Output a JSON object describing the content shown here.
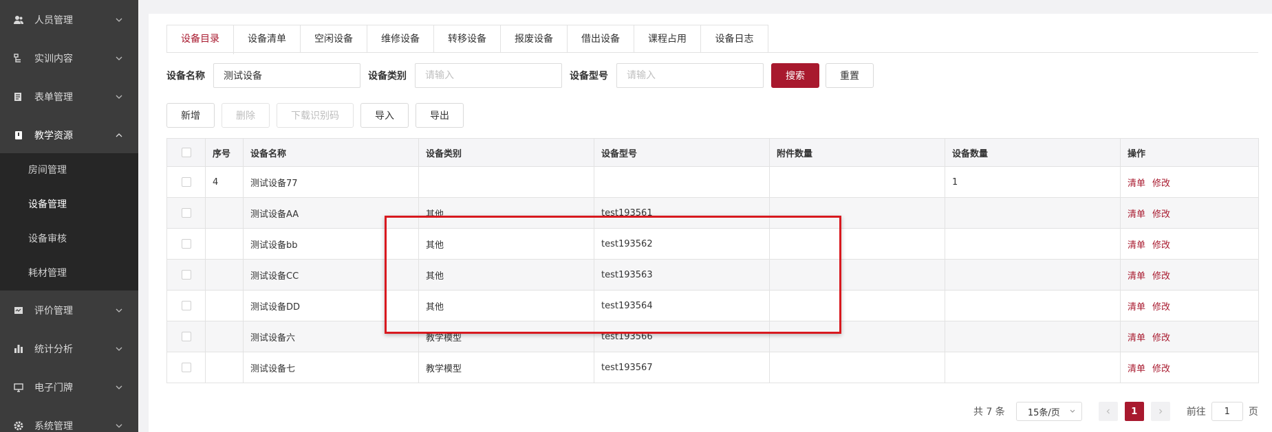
{
  "sidebar": {
    "items": [
      {
        "label": "人员管理",
        "icon": "users-icon"
      },
      {
        "label": "实训内容",
        "icon": "list-icon"
      },
      {
        "label": "表单管理",
        "icon": "form-icon"
      },
      {
        "label": "教学资源",
        "icon": "book-icon"
      },
      {
        "label": "评价管理",
        "icon": "evaluate-icon"
      },
      {
        "label": "统计分析",
        "icon": "bar-chart-icon"
      },
      {
        "label": "电子门牌",
        "icon": "monitor-icon"
      },
      {
        "label": "系统管理",
        "icon": "gear-icon"
      }
    ],
    "submenu": [
      {
        "label": "房间管理"
      },
      {
        "label": "设备管理",
        "active": true
      },
      {
        "label": "设备审核"
      },
      {
        "label": "耗材管理"
      }
    ]
  },
  "tabs": [
    "设备目录",
    "设备清单",
    "空闲设备",
    "维修设备",
    "转移设备",
    "报废设备",
    "借出设备",
    "课程占用",
    "设备日志"
  ],
  "filter": {
    "name_label": "设备名称",
    "name_value": "测试设备",
    "type_label": "设备类别",
    "type_placeholder": "请输入",
    "model_label": "设备型号",
    "model_placeholder": "请输入",
    "search": "搜索",
    "reset": "重置"
  },
  "actions": {
    "add": "新增",
    "delete": "删除",
    "download_code": "下载识别码",
    "import": "导入",
    "export": "导出"
  },
  "table": {
    "headers": [
      "序号",
      "设备名称",
      "设备类别",
      "设备型号",
      "附件数量",
      "设备数量",
      "操作"
    ],
    "rows": [
      {
        "index": "4",
        "name": "测试设备77",
        "type": "",
        "model": "",
        "attachments": "",
        "count": "1"
      },
      {
        "index": "",
        "name": "测试设备AA",
        "type": "其他",
        "model": "test193561",
        "attachments": "",
        "count": ""
      },
      {
        "index": "",
        "name": "测试设备bb",
        "type": "其他",
        "model": "test193562",
        "attachments": "",
        "count": ""
      },
      {
        "index": "",
        "name": "测试设备CC",
        "type": "其他",
        "model": "test193563",
        "attachments": "",
        "count": ""
      },
      {
        "index": "",
        "name": "测试设备DD",
        "type": "其他",
        "model": "test193564",
        "attachments": "",
        "count": ""
      },
      {
        "index": "",
        "name": "测试设备六",
        "type": "教学模型",
        "model": "test193566",
        "attachments": "",
        "count": ""
      },
      {
        "index": "",
        "name": "测试设备七",
        "type": "教学模型",
        "model": "test193567",
        "attachments": "",
        "count": ""
      }
    ],
    "op_list": "清单",
    "op_edit": "修改"
  },
  "pagination": {
    "total": "共 7 条",
    "page_size": "15条/页",
    "current": "1",
    "goto_prefix": "前往",
    "goto_value": "1",
    "goto_suffix": "页"
  },
  "colors": {
    "accent": "#a8192e",
    "highlight": "#d8191f",
    "sidebar_bg": "#3c3c3c",
    "submenu_bg": "#262626"
  }
}
